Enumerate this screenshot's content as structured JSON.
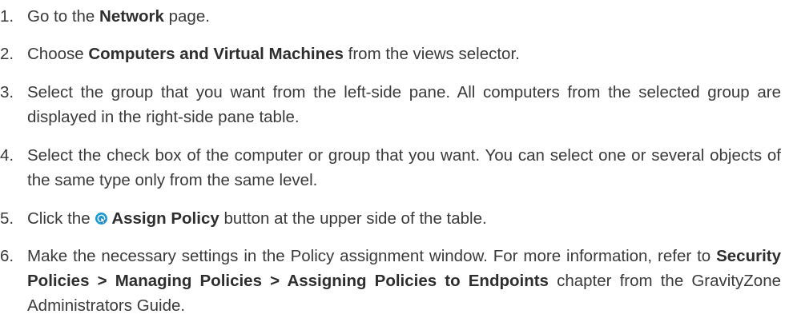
{
  "steps": [
    {
      "number": "1.",
      "parts": [
        "Go to the ",
        "Network",
        " page."
      ]
    },
    {
      "number": "2.",
      "parts": [
        "Choose ",
        "Computers and Virtual Machines",
        " from the views selector."
      ]
    },
    {
      "number": "3.",
      "text": "Select the group that you want from the left-side pane. All computers from the selected group are displayed in the right-side pane table."
    },
    {
      "number": "4.",
      "text": "Select the check box of the computer or group that you want. You can select one or several objects of the same type only from the same level."
    },
    {
      "number": "5.",
      "parts": [
        "Click the ",
        "Assign Policy",
        " button at the upper side of the table."
      ],
      "icon": "assign-policy-icon"
    },
    {
      "number": "6.",
      "parts": [
        "Make the necessary settings in the Policy assignment window. For more information, refer to ",
        "Security Policies > Managing Policies > Assigning Policies to Endpoints",
        " chapter from the GravityZone Administrators Guide."
      ]
    }
  ],
  "colors": {
    "text": "#3a3a3a",
    "icon_accent": "#1a9bd7"
  }
}
